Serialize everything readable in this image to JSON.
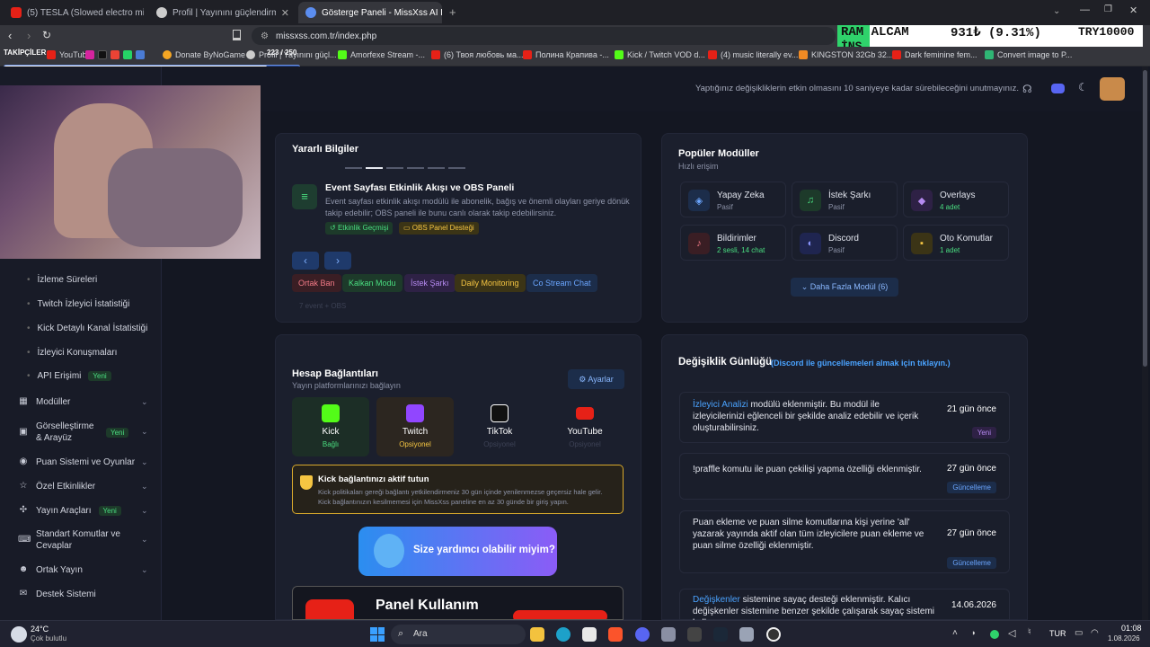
{
  "browser": {
    "tabs": [
      {
        "label": "(5) TESLA (Slowed electro mix) -",
        "active": false
      },
      {
        "label": "Profil | Yayınını güçlendirmek için",
        "active": false
      },
      {
        "label": "Gösterge Paneli - MissXss AI Bot",
        "active": true
      }
    ],
    "new_tab": "+",
    "url": "missxss.com.tr/index.php",
    "bookmarks": [
      "YouTube",
      "Donate ByNoGame",
      "Profil | Yayınını güçl...",
      "Amorfexe Stream -...",
      "(6) Твоя любовь ма...",
      "Полина Крапива -...",
      "Kick / Twitch VOD d...",
      "(4) music literally ev...",
      "KINGSTON 32Gb 32...",
      "Dark feminine fem...",
      "Convert image to P..."
    ],
    "overlay_text": "TAKİPÇİLER",
    "overlay_count": "223 / 250"
  },
  "ticker": {
    "name": "RAM ALCAM",
    "name2": "İNŞ",
    "value": "931₺ (9.31%)",
    "target": "TRY10000"
  },
  "header": {
    "notice": "Yaptığınız değişikliklerin etkin olmasını 10 saniyeye kadar sürebileceğini unutmayınız."
  },
  "sidebar": {
    "sub_items": [
      "İzleme Süreleri",
      "Twitch İzleyici İstatistiği",
      "Kick Detaylı Kanal İstatistiği",
      "İzleyici Konuşmaları",
      "API Erişimi"
    ],
    "new_label": "Yeni",
    "items": [
      "Modüller",
      "Görselleştirme & Arayüz",
      "Puan Sistemi ve Oyunlar",
      "Özel Etkinlikler",
      "Yayın Araçları",
      "Standart Komutlar ve Cevaplar",
      "Ortak Yayın",
      "Destek Sistemi"
    ]
  },
  "info": {
    "title": "Yararlı Bilgiler",
    "item_title": "Event Sayfası Etkinlik Akışı ve OBS Paneli",
    "item_desc": "Event sayfası etkinlik akışı modülü ile abonelik, bağış ve önemli olayları geriye dönük takip edebilir; OBS paneli ile bunu canlı olarak takip edebilirsiniz.",
    "tag1": "Etkinlik Geçmişi",
    "tag2": "OBS Panel Desteği",
    "chips": [
      "Ortak Ban",
      "Kalkan Modu",
      "İstek Şarkı",
      "Daily Monitoring",
      "Co Stream Chat"
    ],
    "faded": "7 event + OBS"
  },
  "modules": {
    "title": "Popüler Modüller",
    "subtitle": "Hızlı erişim",
    "items": [
      {
        "name": "Yapay Zeka",
        "status": "Pasif"
      },
      {
        "name": "İstek Şarkı",
        "status": "Pasif"
      },
      {
        "name": "Overlays",
        "status": "4 adet"
      },
      {
        "name": "Bildirimler",
        "status": "2 sesli, 14 chat"
      },
      {
        "name": "Discord",
        "status": "Pasif"
      },
      {
        "name": "Oto Komutlar",
        "status": "1 adet"
      }
    ],
    "more": "Daha Fazla Modül (6)"
  },
  "accounts": {
    "title": "Hesap Bağlantıları",
    "subtitle": "Yayın platformlarınızı bağlayın",
    "settings": "Ayarlar",
    "platforms": [
      {
        "name": "Kick",
        "status": "Bağlı"
      },
      {
        "name": "Twitch",
        "status": "Opsiyonel"
      },
      {
        "name": "TikTok",
        "status": "Opsiyonel"
      },
      {
        "name": "YouTube",
        "status": "Opsiyonel"
      }
    ],
    "warn_title": "Kick bağlantınızı aktif tutun",
    "warn_text": "Kick politikaları gereği bağlantı yetkilendirmeniz 30 gün içinde yenilenmezse geçersiz hale gelir. Kick bağlantınızın kesilmemesi için MissXss paneline en az 30 günde bir giriş yapın.",
    "help": "Size yardımcı olabilir miyim?",
    "video_title": "Panel Kullanım",
    "yt": "YouTube"
  },
  "changelog": {
    "title": "Değişiklik Günlüğü",
    "link": "(Discord ile güncellemeleri almak için tıklayın.)",
    "entries": [
      {
        "highlight": "İzleyici Analizi",
        "text": " modülü eklenmiştir. Bu modül ile izleyicilerinizi eğlenceli bir şekilde analiz edebilir ve içerik oluşturabilirsiniz.",
        "date": "21 gün önce",
        "badge": "Yeni"
      },
      {
        "highlight": "",
        "text": "!praffle komutu ile puan çekilişi yapma özelliği eklenmiştir.",
        "date": "27 gün önce",
        "badge": "Güncelleme"
      },
      {
        "highlight": "",
        "text": "Puan ekleme ve puan silme komutlarına kişi yerine 'all' yazarak yayında aktif olan tüm izleyicilere puan ekleme ve puan silme özelliği eklenmiştir.",
        "date": "27 gün önce",
        "badge": "Güncelleme"
      },
      {
        "highlight": "Değişkenler",
        "text": " sistemine sayaç desteği eklenmiştir. Kalıcı değişkenler sistemine benzer şekilde çalışarak sayaç sistemi kullanmanızı",
        "date": "14.06.2026",
        "badge": ""
      }
    ]
  },
  "taskbar": {
    "temp": "24°C",
    "weather": "Çok bulutlu",
    "search": "Ara",
    "lang": "TUR",
    "time": "01:08",
    "date": "1.08.2026"
  }
}
